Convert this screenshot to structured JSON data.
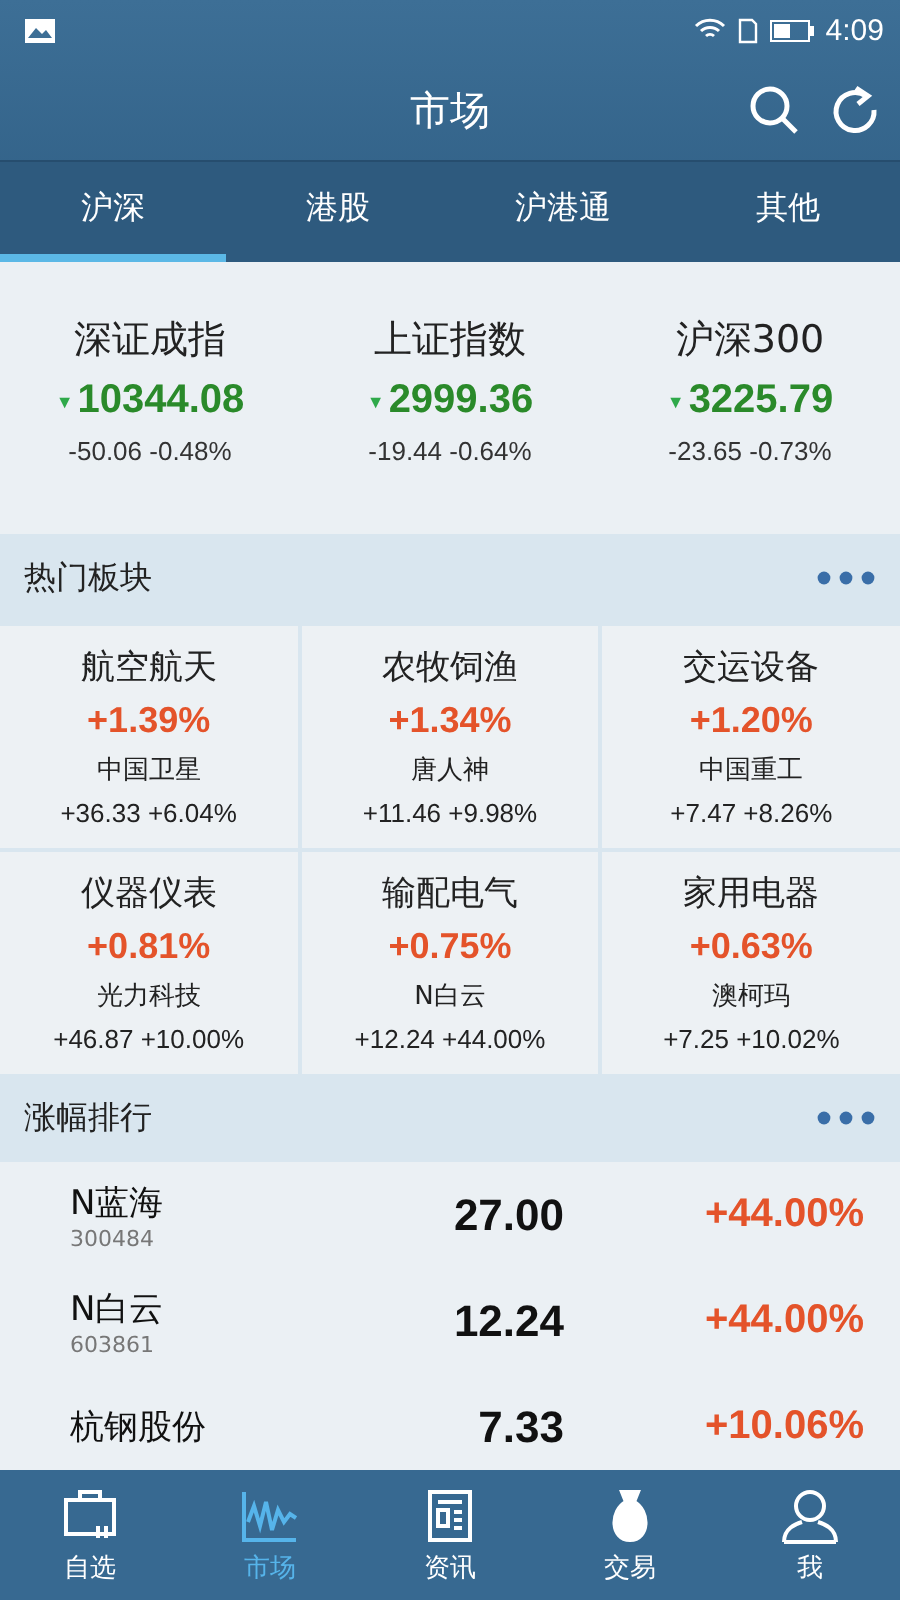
{
  "status_bar": {
    "time": "4:09"
  },
  "header": {
    "title": "市场"
  },
  "tabs": [
    {
      "label": "沪深",
      "selected": true
    },
    {
      "label": "港股",
      "selected": false
    },
    {
      "label": "沪港通",
      "selected": false
    },
    {
      "label": "其他",
      "selected": false
    }
  ],
  "indices": [
    {
      "name": "深证成指",
      "arrow": "▼",
      "value": "10344.08",
      "change": "-50.06 -0.48%"
    },
    {
      "name": "上证指数",
      "arrow": "▼",
      "value": "2999.36",
      "change": "-19.44 -0.64%"
    },
    {
      "name": "沪深300",
      "arrow": "▼",
      "value": "3225.79",
      "change": "-23.65 -0.73%"
    }
  ],
  "hot_sectors": {
    "title": "热门板块",
    "items": [
      {
        "name": "航空航天",
        "percent": "+1.39%",
        "leader": "中国卫星",
        "leader_change": "+36.33 +6.04%"
      },
      {
        "name": "农牧饲渔",
        "percent": "+1.34%",
        "leader": "唐人神",
        "leader_change": "+11.46 +9.98%"
      },
      {
        "name": "交运设备",
        "percent": "+1.20%",
        "leader": "中国重工",
        "leader_change": "+7.47 +8.26%"
      },
      {
        "name": "仪器仪表",
        "percent": "+0.81%",
        "leader": "光力科技",
        "leader_change": "+46.87 +10.00%"
      },
      {
        "name": "输配电气",
        "percent": "+0.75%",
        "leader": "N白云",
        "leader_change": "+12.24 +44.00%"
      },
      {
        "name": "家用电器",
        "percent": "+0.63%",
        "leader": "澳柯玛",
        "leader_change": "+7.25 +10.02%"
      }
    ]
  },
  "gainers": {
    "title": "涨幅排行",
    "rows": [
      {
        "name": "N蓝海",
        "code": "300484",
        "price": "27.00",
        "percent": "+44.00%"
      },
      {
        "name": "N白云",
        "code": "603861",
        "price": "12.24",
        "percent": "+44.00%"
      },
      {
        "name": "杭钢股份",
        "price": "7.33",
        "percent": "+10.06%"
      }
    ]
  },
  "bottom_nav": [
    {
      "label": "自选",
      "kind": "portfolio",
      "selected": false
    },
    {
      "label": "市场",
      "kind": "chart",
      "selected": true
    },
    {
      "label": "资讯",
      "kind": "news",
      "selected": false
    },
    {
      "label": "交易",
      "kind": "moneybag",
      "selected": false
    },
    {
      "label": "我",
      "kind": "person",
      "selected": false
    }
  ]
}
